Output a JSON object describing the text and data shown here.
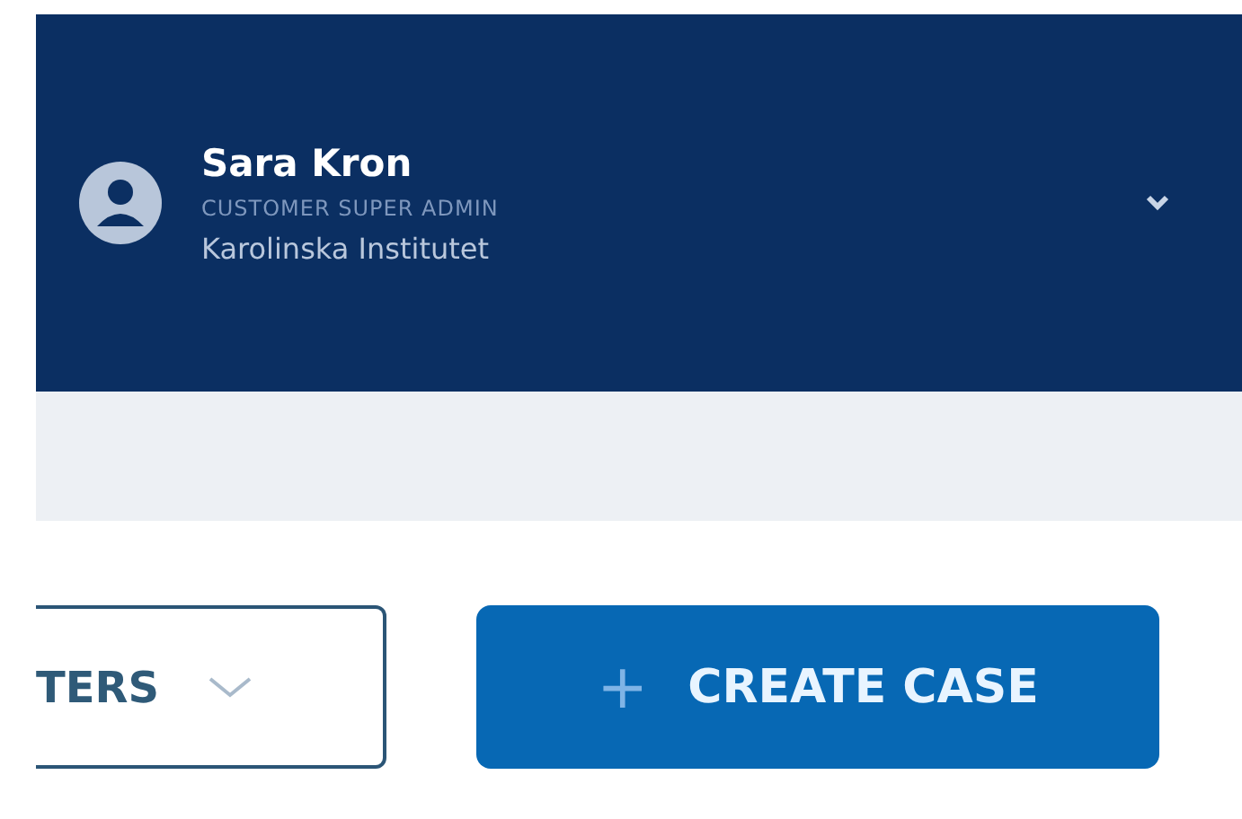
{
  "user": {
    "name": "Sara Kron",
    "role": "CUSTOMER SUPER ADMIN",
    "organization": "Karolinska Institutet"
  },
  "toolbar": {
    "filters_button": "TERS",
    "create_button": {
      "icon": "+",
      "label": "CREATE CASE"
    }
  }
}
